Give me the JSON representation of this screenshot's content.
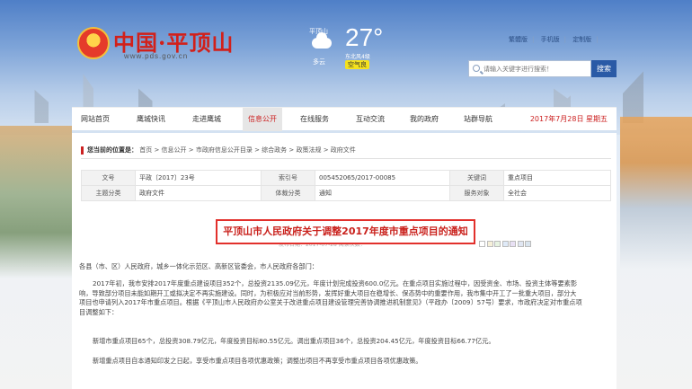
{
  "header": {
    "logo_title": "中国·平顶山",
    "logo_url": "www.pds.gov.cn",
    "weather": {
      "city": "平顶山",
      "desc": "多云",
      "temp": "27°",
      "wind": "东北风4级",
      "aqi": "空气良"
    },
    "top_links": [
      "繁體版",
      "手机版",
      "定制版"
    ],
    "search": {
      "placeholder": "请输入关键字进行搜索！",
      "button": "搜索"
    }
  },
  "nav": {
    "items": [
      "网站首页",
      "鹰城快讯",
      "走进鹰城",
      "信息公开",
      "在线服务",
      "互动交流",
      "我的政府",
      "站群导航"
    ],
    "active_index": 3,
    "date": "2017年7月28日 星期五"
  },
  "breadcrumb": {
    "label": "您当前的位置是：",
    "path": "首页 > 信息公开 > 市政府信息公开目录 > 综合政务 > 政策法规 > 政府文件"
  },
  "meta_table": {
    "rows": [
      [
        "文号",
        "平政〔2017〕23号",
        "索引号",
        "005452065/2017-00085",
        "关键词",
        "重点项目"
      ],
      [
        "主题分类",
        "政府文件",
        "体裁分类",
        "通知",
        "服务对象",
        "全社会"
      ]
    ]
  },
  "article": {
    "title": "平顶山市人民政府关于调整2017年度市重点项目的通知",
    "byline": "发布日期：2017-07-28  阅读次数：",
    "swatch_colors": [
      "#ffffff",
      "#f6f0d9",
      "#e7f3e1",
      "#dfeaf8",
      "#e8e0f4",
      "#e0e6f2",
      "#d9e4ee"
    ],
    "salutation": "各县（市、区）人民政府，城乡一体化示范区、高新区管委会，市人民政府各部门：",
    "para1": "2017年初，我市安排2017年度重点建设项目352个，总投资2135.09亿元，年度计划完成投资600.0亿元。在重点项目实施过程中，因受资金、市场、投资主体等要素影响，导致部分项目未能如期开工或拟决定不再实施建设。同时，为积极应对当前形势，发挥好重大项目在稳增长、保态势中的重要作用，我市集中开工了一批重大项目，部分大项目也申请列入2017年市重点项目。根据《平顶山市人民政府办公室关于改进重点项目建设管理完善协调推进机制意见》（平政办〔2009〕57号）要求，市政府决定对市重点项目调整如下：",
    "para2": "新增市重点项目65个，总投资308.79亿元，年度投资目标80.55亿元。调出重点项目36个，总投资204.45亿元，年度投资目标66.77亿元。",
    "para3": "新增重点项目自本通知印发之日起，享受市重点项目各项优惠政策；调整出项目不再享受市重点项目各项优惠政策。"
  }
}
